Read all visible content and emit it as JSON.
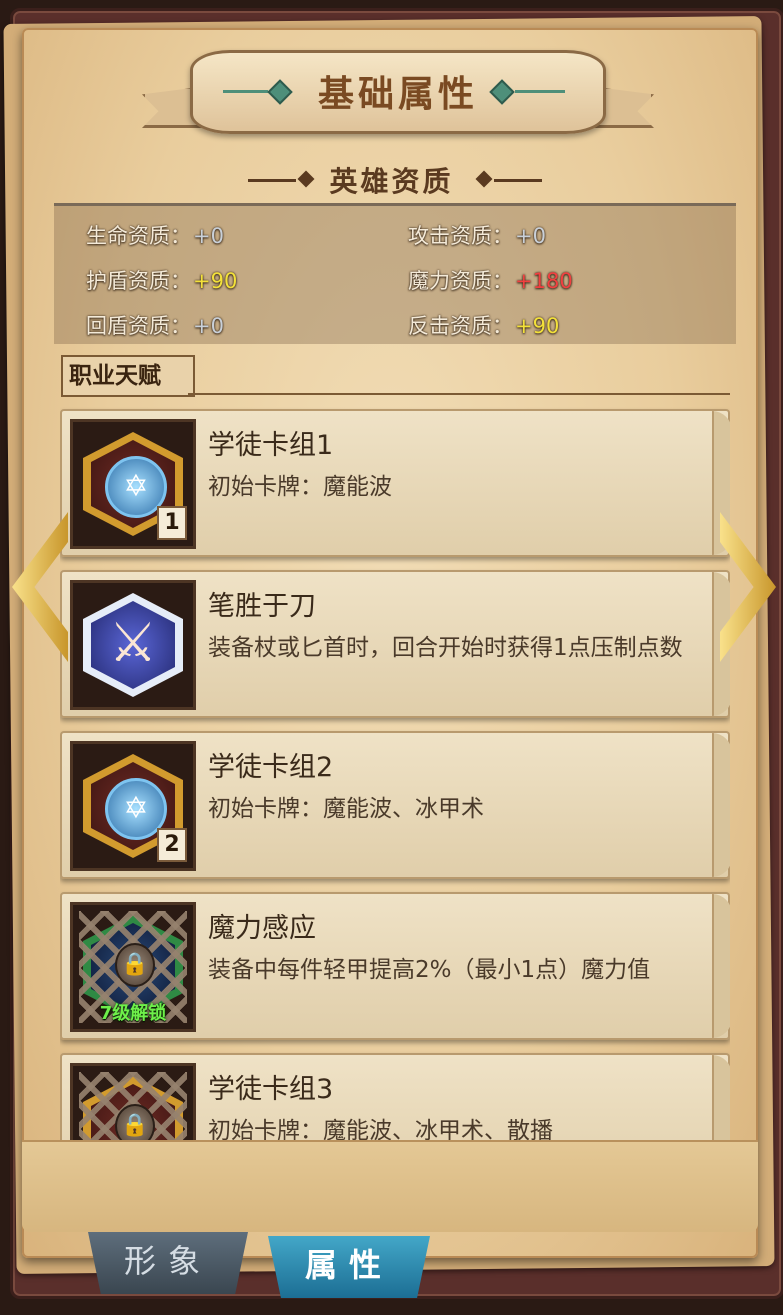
{
  "header": {
    "title": "基础属性"
  },
  "aptitude": {
    "title": "英雄资质",
    "stats": [
      {
        "label": "生命资质：",
        "value": "+0",
        "color": "#c9d0d8"
      },
      {
        "label": "攻击资质：",
        "value": "+0",
        "color": "#c9d0d8"
      },
      {
        "label": "护盾资质：",
        "value": "+90",
        "color": "#f3e13a"
      },
      {
        "label": "魔力资质：",
        "value": "+180",
        "color": "#f04040"
      },
      {
        "label": "回盾资质：",
        "value": "+0",
        "color": "#c9d0d8"
      },
      {
        "label": "反击资质：",
        "value": "+90",
        "color": "#f3e13a"
      }
    ]
  },
  "talents": {
    "section_label": "职业天赋",
    "items": [
      {
        "title": "学徒卡组1",
        "desc": "初始卡牌：魔能波",
        "icon": "hexagram-card-icon",
        "badge": "1",
        "locked": false
      },
      {
        "title": "笔胜于刀",
        "desc": "装备杖或匕首时，回合开始时获得1点压制点数",
        "icon": "crossed-swords-icon",
        "badge": "",
        "locked": false
      },
      {
        "title": "学徒卡组2",
        "desc": "初始卡牌：魔能波、冰甲术",
        "icon": "hexagram-card-icon",
        "badge": "2",
        "locked": false
      },
      {
        "title": "魔力感应",
        "desc": "装备中每件轻甲提高2%（最小1点）魔力值",
        "icon": "locked-chain-icon",
        "badge": "",
        "locked": true,
        "unlock_text": "7级解锁"
      },
      {
        "title": "学徒卡组3",
        "desc": "初始卡牌：魔能波、冰甲术、散播",
        "icon": "locked-chain-icon",
        "badge": "",
        "locked": true
      }
    ]
  },
  "tabs": [
    {
      "label": "形象",
      "active": false
    },
    {
      "label": "属性",
      "active": true
    }
  ]
}
